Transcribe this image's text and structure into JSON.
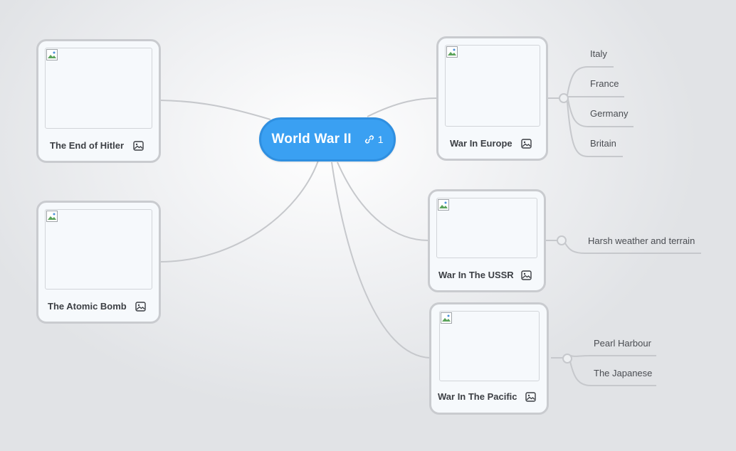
{
  "root": {
    "title": "World War II",
    "link_count": "1"
  },
  "left_topics": [
    {
      "label": "The End of Hitler"
    },
    {
      "label": "The Atomic Bomb"
    }
  ],
  "right_topics": [
    {
      "label": "War In Europe",
      "subtopics": [
        "Italy",
        "France",
        "Germany",
        "Britain"
      ]
    },
    {
      "label": "War In The USSR",
      "subtopics": [
        "Harsh weather and terrain"
      ]
    },
    {
      "label": "War In The Pacific",
      "subtopics": [
        "Pearl Harbour",
        "The Japanese"
      ]
    }
  ],
  "colors": {
    "root_fill": "#3aa0f2",
    "connector": "#c6c8cc",
    "card_border": "#c9cbcf"
  }
}
